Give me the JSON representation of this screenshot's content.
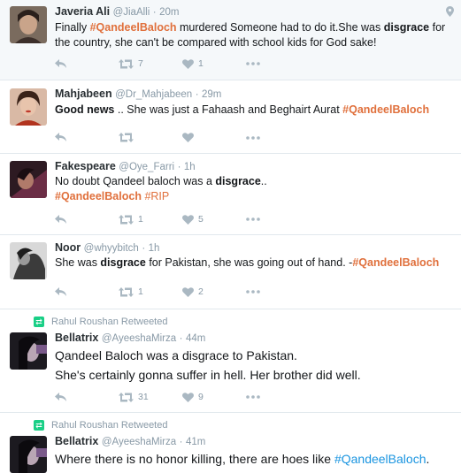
{
  "colors": {
    "hashtag": "#e0703c",
    "link": "#1b95e0",
    "meta": "#8899a6",
    "retweet": "#19cf86"
  },
  "icons": {
    "reply": "reply-icon",
    "retweet": "retweet-icon",
    "like": "heart-icon",
    "more": "more-icon",
    "location": "location-pin-icon"
  },
  "tweets": [
    {
      "name": "Javeria Ali",
      "handle": "@JiaAlli",
      "time": "20m",
      "text": {
        "t1": "Finally ",
        "tag1": "#QandeelBaloch",
        "t2": " murdered Someone had to do it.She was ",
        "em1": "disgrace",
        "t3": " for the country, she can't be compared with school kids for God sake!"
      },
      "retweets": "7",
      "likes": "1"
    },
    {
      "name": "Mahjabeen",
      "handle": "@Dr_Mahjabeen",
      "time": "29m",
      "text": {
        "em1": "Good news",
        "t1": " .. She was just a Fahaash and Beghairt Aurat ",
        "tag1": "#QandeelBaloch"
      },
      "retweets": "",
      "likes": ""
    },
    {
      "name": "Fakespeare",
      "handle": "@Oye_Farri",
      "time": "1h",
      "text": {
        "t1": "No doubt Qandeel baloch was a ",
        "em1": "disgrace",
        "t2": "..",
        "tag1": "#QandeelBaloch",
        "tag2": "#RIP"
      },
      "retweets": "1",
      "likes": "5"
    },
    {
      "name": "Noor",
      "handle": "@whyybitch",
      "time": "1h",
      "text": {
        "t1": "She was ",
        "em1": "disgrace",
        "t2": " for Pakistan, she was going out of hand. -",
        "tag1": "#QandeelBaloch"
      },
      "retweets": "1",
      "likes": "2"
    },
    {
      "context": "Rahul Roushan Retweeted",
      "name": "Bellatrix",
      "handle": "@AyeeshaMirza",
      "time": "44m",
      "text": {
        "line1": "Qandeel Baloch was a disgrace to Pakistan.",
        "line2": "She's certainly gonna suffer in hell. Her brother did well."
      },
      "retweets": "31",
      "likes": "9"
    },
    {
      "context": "Rahul Roushan Retweeted",
      "name": "Bellatrix",
      "handle": "@AyeeshaMirza",
      "time": "41m",
      "text": {
        "t1": "Where there is no honor killing, there are hoes like ",
        "tag1": "#QandeelBaloch",
        "t2": "."
      },
      "retweets": "",
      "likes": ""
    }
  ]
}
